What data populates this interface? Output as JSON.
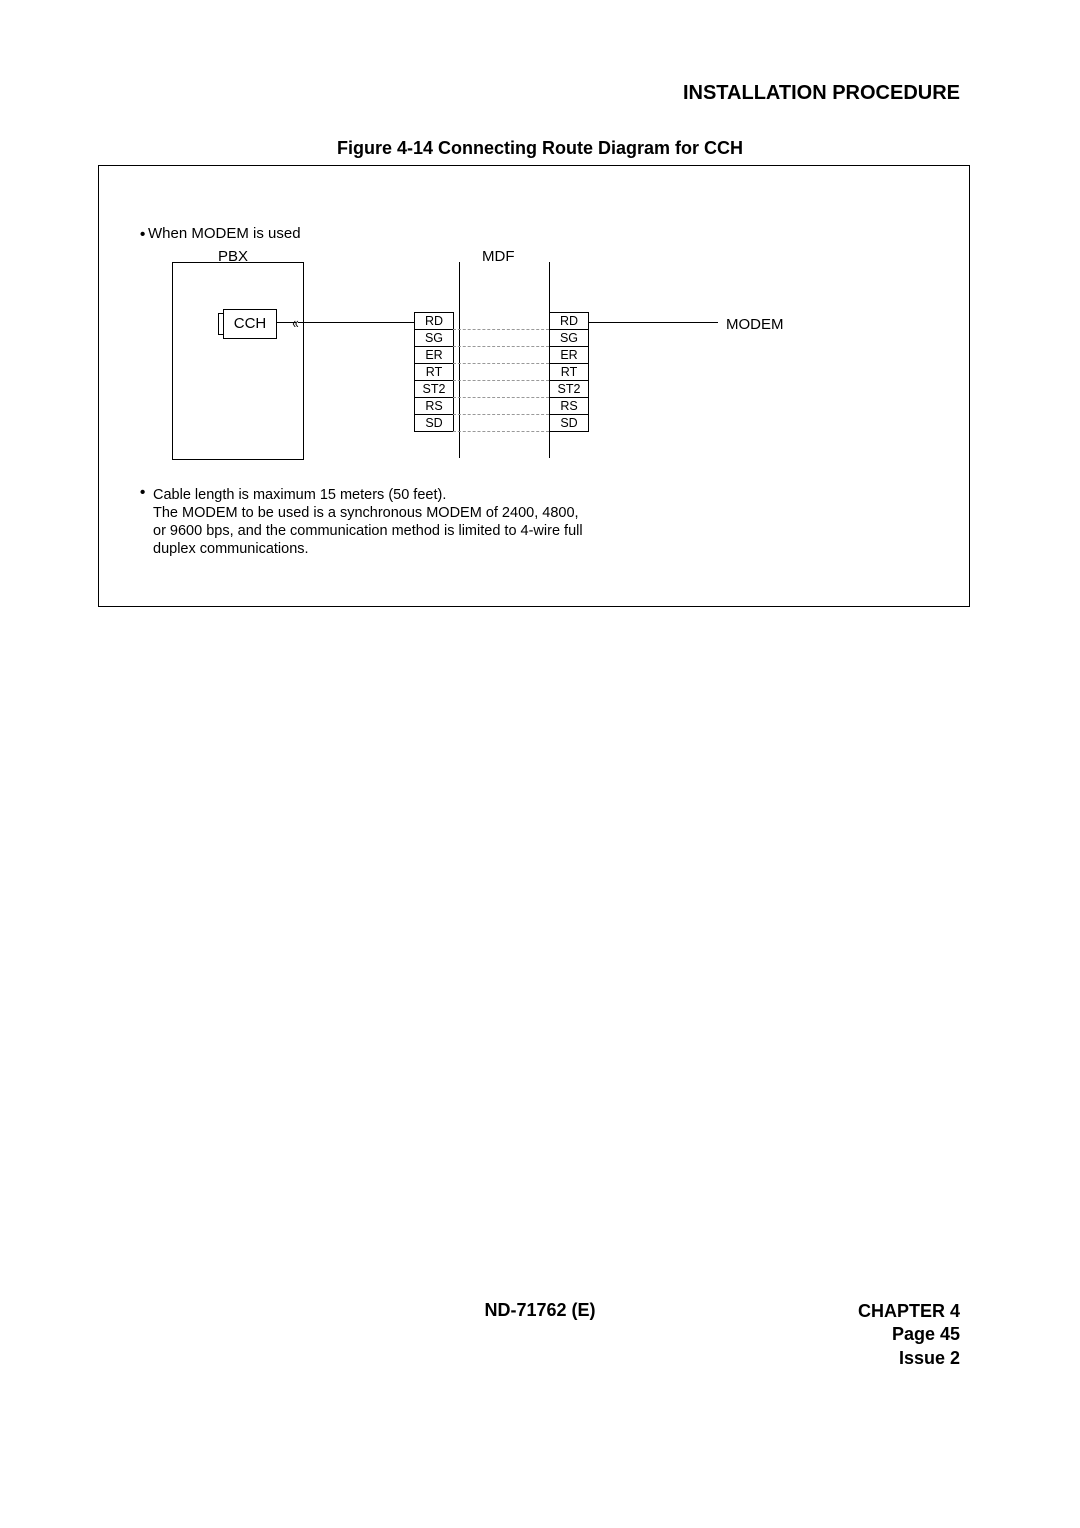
{
  "header": {
    "title": "INSTALLATION PROCEDURE"
  },
  "figure": {
    "caption": "Figure 4-14   Connecting Route Diagram for CCH"
  },
  "diagram": {
    "note1": "When MODEM is used",
    "pbx": "PBX",
    "mdf": "MDF",
    "cch": "CCH",
    "modem": "MODEM",
    "signals": [
      "RD",
      "SG",
      "ER",
      "RT",
      "ST2",
      "RS",
      "SD"
    ],
    "note2": "Cable length is maximum 15 meters (50 feet).\nThe MODEM to be used is a synchronous MODEM of 2400, 4800,\nor 9600 bps, and the communication method is limited to 4-wire full\nduplex communications."
  },
  "footer": {
    "doc": "ND-71762 (E)",
    "chapter": "CHAPTER 4",
    "page": "Page 45",
    "issue": "Issue 2"
  }
}
